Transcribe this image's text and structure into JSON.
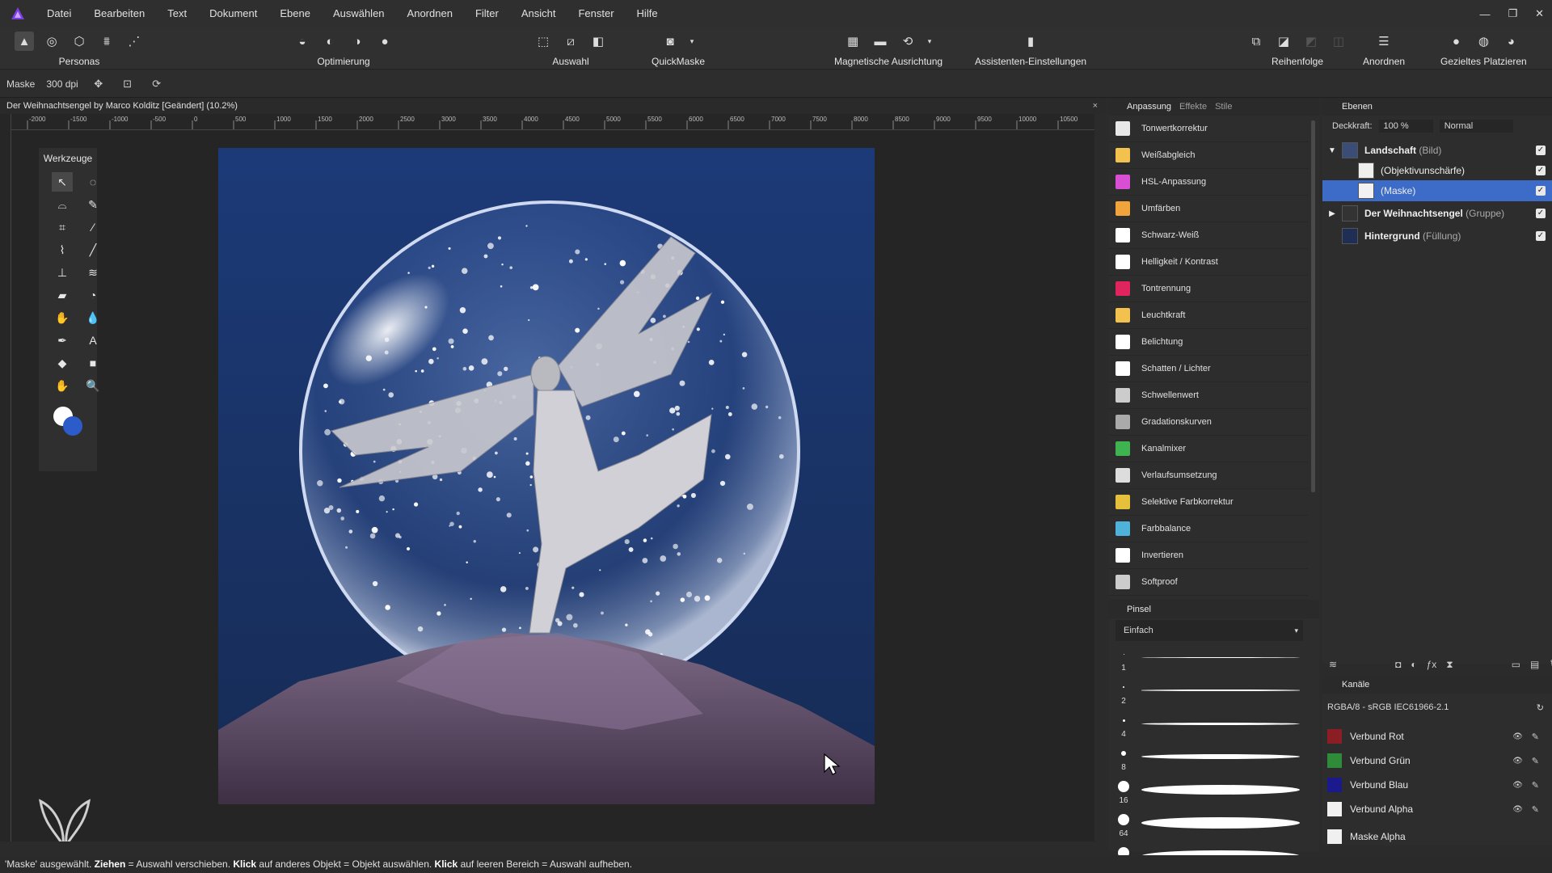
{
  "menu": {
    "items": [
      "Datei",
      "Bearbeiten",
      "Text",
      "Dokument",
      "Ebene",
      "Auswählen",
      "Anordnen",
      "Filter",
      "Ansicht",
      "Fenster",
      "Hilfe"
    ]
  },
  "toolbar": {
    "personas_label": "Personas",
    "optimierung_label": "Optimierung",
    "auswahl_label": "Auswahl",
    "quickmaske_label": "QuickMaske",
    "magnetische_label": "Magnetische Ausrichtung",
    "assistenten_label": "Assistenten-Einstellungen",
    "reihenfolge_label": "Reihenfolge",
    "anordnen_label": "Anordnen",
    "gezieltes_label": "Gezieltes Platzieren"
  },
  "context": {
    "mode": "Maske",
    "dpi": "300 dpi"
  },
  "document": {
    "tab_title": "Der Weihnachtsengel by Marco Kolditz [Geändert] (10.2%)",
    "close": "×"
  },
  "ruler": {
    "ticks": [
      "-2000",
      "-1500",
      "-1000",
      "-500",
      "0",
      "500",
      "1000",
      "1500",
      "2000",
      "2500",
      "3000",
      "3500",
      "4000",
      "4500",
      "5000",
      "5500",
      "6000",
      "6500",
      "7000",
      "7500",
      "8000",
      "8500",
      "9000",
      "9500",
      "10000",
      "10500"
    ]
  },
  "tools": {
    "title": "Werkzeuge"
  },
  "adjustments": {
    "tabs": [
      "Anpassung",
      "Effekte",
      "Stile"
    ],
    "items": [
      {
        "label": "Tonwertkorrektur",
        "color": "#e8e8e8"
      },
      {
        "label": "Weißabgleich",
        "color": "#f2c14e"
      },
      {
        "label": "HSL-Anpassung",
        "color": "#d94fd3"
      },
      {
        "label": "Umfärben",
        "color": "#f2a43c"
      },
      {
        "label": "Schwarz-Weiß",
        "color": "#ffffff"
      },
      {
        "label": "Helligkeit / Kontrast",
        "color": "#ffffff"
      },
      {
        "label": "Tontrennung",
        "color": "#e0245e"
      },
      {
        "label": "Leuchtkraft",
        "color": "#f2c14e"
      },
      {
        "label": "Belichtung",
        "color": "#ffffff"
      },
      {
        "label": "Schatten / Lichter",
        "color": "#ffffff"
      },
      {
        "label": "Schwellenwert",
        "color": "#cccccc"
      },
      {
        "label": "Gradationskurven",
        "color": "#aaaaaa"
      },
      {
        "label": "Kanalmixer",
        "color": "#3fb34f"
      },
      {
        "label": "Verlaufsumsetzung",
        "color": "#dddddd"
      },
      {
        "label": "Selektive Farbkorrektur",
        "color": "#e6c03b"
      },
      {
        "label": "Farbbalance",
        "color": "#4fb3d9"
      },
      {
        "label": "Invertieren",
        "color": "#ffffff"
      },
      {
        "label": "Softproof",
        "color": "#cccccc"
      }
    ]
  },
  "brushes": {
    "title": "Pinsel",
    "category": "Einfach",
    "sizes": [
      "1",
      "2",
      "4",
      "8",
      "16",
      "64",
      ""
    ]
  },
  "layers": {
    "title": "Ebenen",
    "opacity_label": "Deckkraft:",
    "opacity_value": "100 %",
    "blend_mode": "Normal",
    "items": [
      {
        "name": "Landschaft",
        "type": "(Bild)"
      },
      {
        "name": "(Objektivunschärfe)",
        "type": ""
      },
      {
        "name": "(Maske)",
        "type": ""
      },
      {
        "name": "Der Weihnachtsengel",
        "type": "(Gruppe)"
      },
      {
        "name": "Hintergrund",
        "type": "(Füllung)"
      }
    ]
  },
  "channels": {
    "title": "Kanäle",
    "profile": "RGBA/8 - sRGB IEC61966-2.1",
    "items": [
      {
        "label": "Verbund Rot",
        "color": "#8a1e24"
      },
      {
        "label": "Verbund Grün",
        "color": "#2f8a3a"
      },
      {
        "label": "Verbund Blau",
        "color": "#1a1a8c"
      },
      {
        "label": "Verbund Alpha",
        "color": "#f0f0f0"
      },
      {
        "label": "Maske Alpha",
        "color": "#f0f0f0"
      }
    ]
  },
  "status": {
    "prefix": "'Maske' ausgewählt. ",
    "b1": "Ziehen",
    "t1": " = Auswahl verschieben. ",
    "b2": "Klick",
    "t2": " auf anderes Objekt = Objekt auswählen. ",
    "b3": "Klick",
    "t3": " auf leeren Bereich = Auswahl aufheben."
  }
}
